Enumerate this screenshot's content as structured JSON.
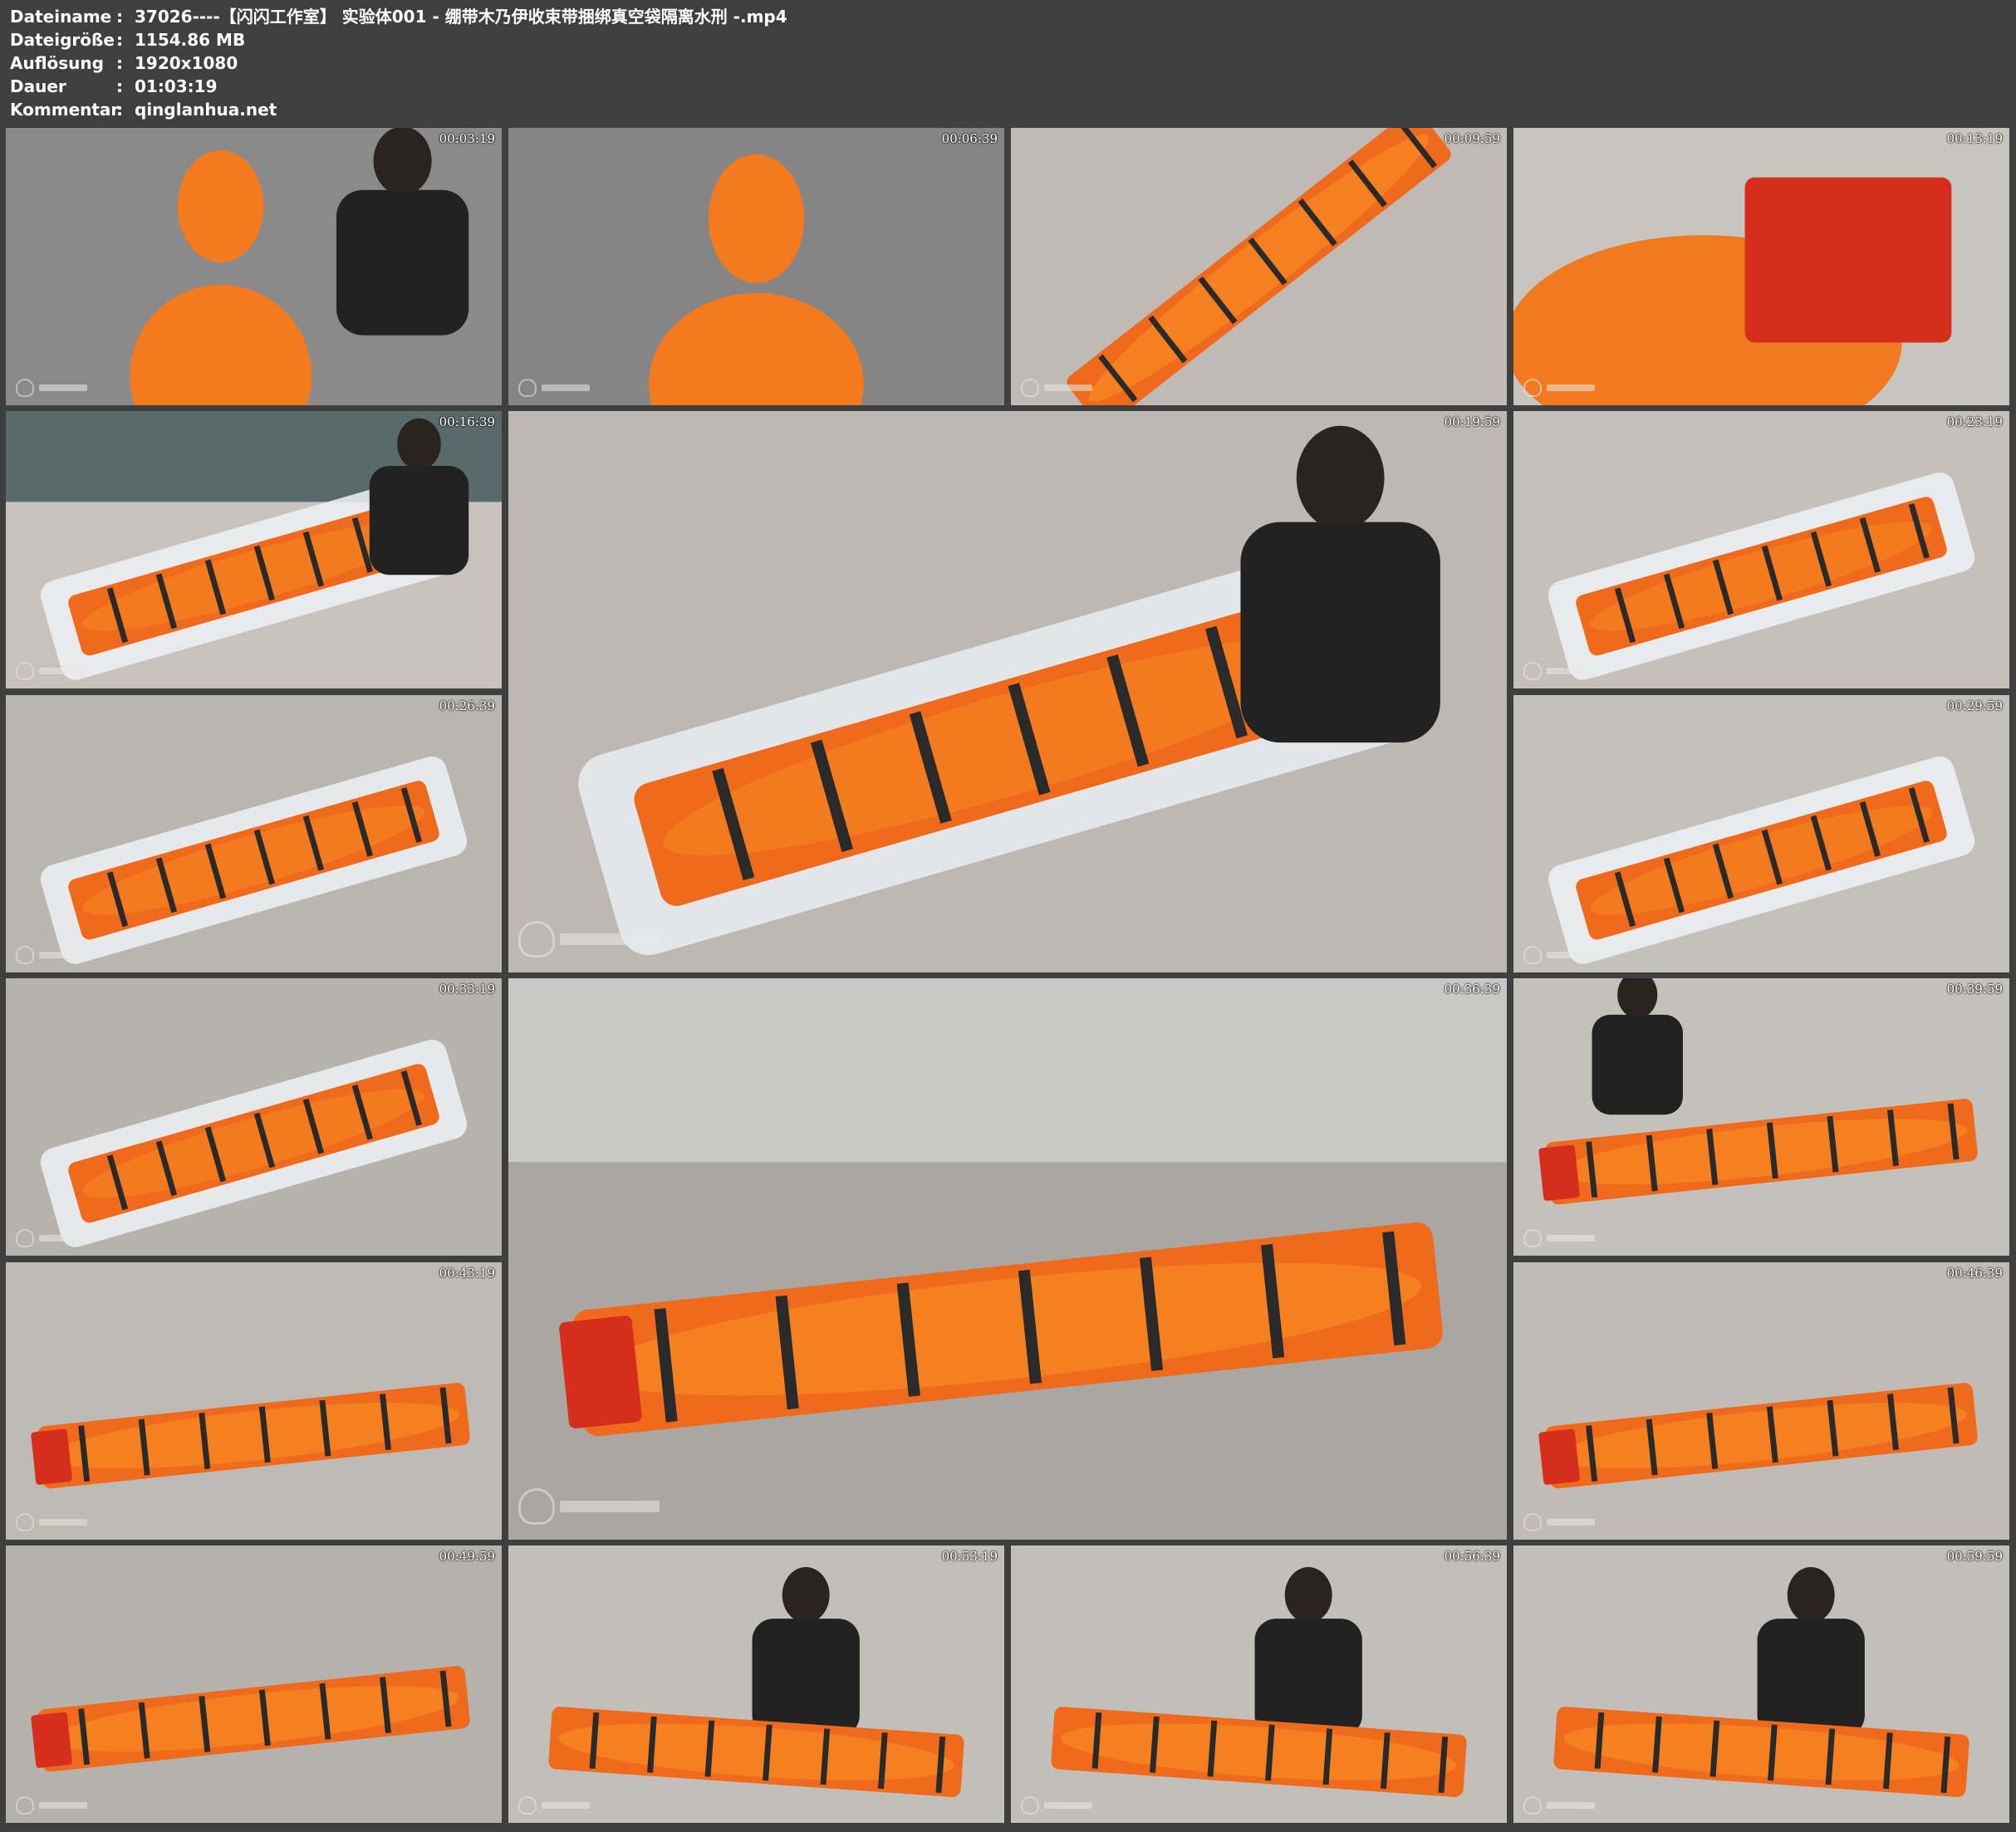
{
  "info": [
    {
      "key": "Dateiname",
      "value": "37026----【闪闪工作室】 实验体001 - 绷带木乃伊收束带捆绑真空袋隔离水刑 -.mp4"
    },
    {
      "key": "Dateigröße",
      "value": "1154.86 MB"
    },
    {
      "key": "Auflösung",
      "value": "1920x1080"
    },
    {
      "key": "Dauer",
      "value": "01:03:19"
    },
    {
      "key": "Kommentar",
      "value": "qinglanhua.net"
    }
  ],
  "separator": ":",
  "thumbnails": [
    {
      "time": "00:03:19",
      "scene": "person-wrapping-head",
      "colors": {
        "wall": "#8a8a8a",
        "body": "#f47a1f",
        "shirt": "#222222"
      }
    },
    {
      "time": "00:06:39",
      "scene": "wrapped-figure",
      "colors": {
        "wall": "#858585",
        "body": "#f47a1f"
      }
    },
    {
      "time": "00:09:59",
      "scene": "strapped-board",
      "colors": {
        "floor": "#bfbab4",
        "body": "#f4801f",
        "board": "#f06a1e"
      }
    },
    {
      "time": "00:13:19",
      "scene": "head-block-closeup",
      "colors": {
        "floor": "#c8c4be",
        "body": "#f07a1f",
        "block": "#d52f1c"
      }
    },
    {
      "time": "00:16:39",
      "scene": "room-vacuum-bag",
      "colors": {
        "floor": "#c7c2bb",
        "wall": "#5a6a6a",
        "body": "#f47a1f"
      }
    },
    {
      "time": "00:19:59",
      "scene": "vacuum-bag-large",
      "colors": {
        "floor": "#bdb8b2",
        "body": "#f47a1f",
        "bag": "#e9edf2"
      }
    },
    {
      "time": "00:23:19",
      "scene": "vacuum-bag",
      "colors": {
        "floor": "#c5c0ba",
        "body": "#f47a1f",
        "bag": "#eef1f4"
      }
    },
    {
      "time": "00:26:39",
      "scene": "vacuum-bag",
      "colors": {
        "floor": "#b9b5af",
        "body": "#f47a1f",
        "bag": "#eef1f4"
      }
    },
    {
      "time": "00:29:59",
      "scene": "vacuum-bag-top",
      "colors": {
        "floor": "#c4c0ba",
        "body": "#f47a1f",
        "bag": "#eef1f4"
      }
    },
    {
      "time": "00:33:19",
      "scene": "vacuum-bag-feet",
      "colors": {
        "floor": "#b6b2ac",
        "body": "#f47a1f",
        "bag": "#eef1f4"
      }
    },
    {
      "time": "00:36:39",
      "scene": "board-large",
      "colors": {
        "floor": "#aaa6a0",
        "wall": "#c8c8c6",
        "body": "#f4801f",
        "block": "#d52f1c"
      }
    },
    {
      "time": "00:39:59",
      "scene": "board-kneeling",
      "colors": {
        "floor": "#c4c0ba",
        "body": "#f4801f",
        "block": "#d52f1c"
      }
    },
    {
      "time": "00:43:19",
      "scene": "board-side",
      "colors": {
        "floor": "#bdb9b3",
        "body": "#f4801f",
        "block": "#d52f1c"
      }
    },
    {
      "time": "00:46:39",
      "scene": "board-head-closeup",
      "colors": {
        "floor": "#c0bbb5",
        "body": "#f4801f",
        "block": "#d52f1c"
      }
    },
    {
      "time": "00:49:59",
      "scene": "danger-closeup",
      "colors": {
        "floor": "#b5b1ab",
        "body": "#f4801f",
        "block": "#d52f1c"
      }
    },
    {
      "time": "00:53:19",
      "scene": "person-kneeling-board",
      "colors": {
        "floor": "#c2beb8",
        "body": "#f4801f",
        "shirt": "#222222"
      }
    },
    {
      "time": "00:56:39",
      "scene": "person-kneeling-board",
      "colors": {
        "floor": "#c2beb8",
        "body": "#f4801f",
        "shirt": "#222222"
      }
    },
    {
      "time": "00:59:59",
      "scene": "person-kneeling-board",
      "colors": {
        "floor": "#c2beb8",
        "body": "#f4801f",
        "shirt": "#222222"
      }
    }
  ]
}
